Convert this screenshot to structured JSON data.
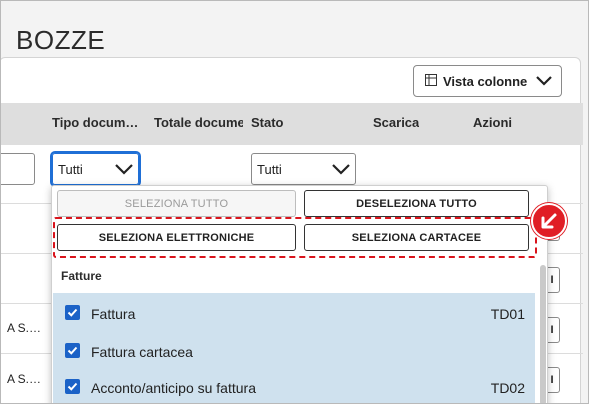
{
  "page": {
    "title": "BOZZE"
  },
  "toolbar": {
    "vista_colonne_label": "Vista colonne",
    "vista_icon": "columns-icon"
  },
  "table": {
    "headers": [
      "Tipo docum…",
      "Totale docume",
      "Stato",
      "Scarica",
      "Azioni"
    ],
    "filters": {
      "tipo_documento": "Tutti",
      "stato": "Tutti"
    },
    "row_fragments": [
      "A S.…",
      "A S.…"
    ],
    "action_glyph": "I"
  },
  "dropdown": {
    "select_all": "SELEZIONA TUTTO",
    "deselect_all": "DESELEZIONA TUTTO",
    "select_electronic": "SELEZIONA ELETTRONICHE",
    "select_paper": "SELEZIONA CARTACEE",
    "group_label": "Fatture",
    "options": [
      {
        "label": "Fattura",
        "code": "TD01",
        "checked": true
      },
      {
        "label": "Fattura cartacea",
        "code": "",
        "checked": true
      },
      {
        "label": "Acconto/anticipo su fattura",
        "code": "TD02",
        "checked": true
      }
    ]
  },
  "colors": {
    "highlight": "#d9141c",
    "checkbox": "#1b62c7",
    "selected_bg": "#cfe1ee",
    "focus": "#1f6fd6"
  }
}
